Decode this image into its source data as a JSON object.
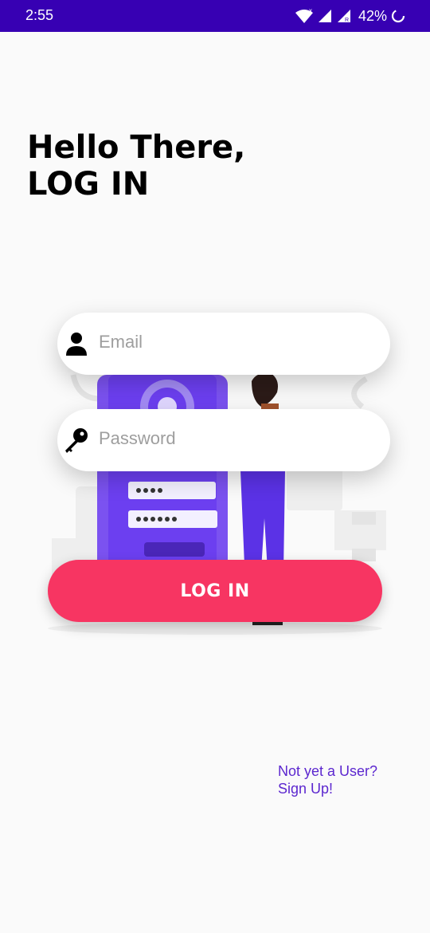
{
  "status_bar": {
    "time": "2:55",
    "battery_percent": "42%",
    "network_badge_x": "x",
    "network_badge_r": "R",
    "icons": [
      "wifi-icon",
      "mobile-signal-icon",
      "mobile-signal-roaming-icon",
      "battery-icon"
    ],
    "background": "#3700b3"
  },
  "header": {
    "line1": "Hello There,",
    "line2": "LOG IN"
  },
  "form": {
    "email": {
      "placeholder": "Email",
      "icon": "person-icon"
    },
    "password": {
      "placeholder": "Password",
      "icon": "key-icon"
    },
    "illustration_icon": "login-illustration",
    "login_button_label": "LOG IN"
  },
  "footer": {
    "signup_line1": "Not yet a User?",
    "signup_line2": "Sign Up!"
  },
  "colors": {
    "accent": "#f73562",
    "link": "#5c27cf",
    "illustration_purple": "#6c3ff0"
  }
}
